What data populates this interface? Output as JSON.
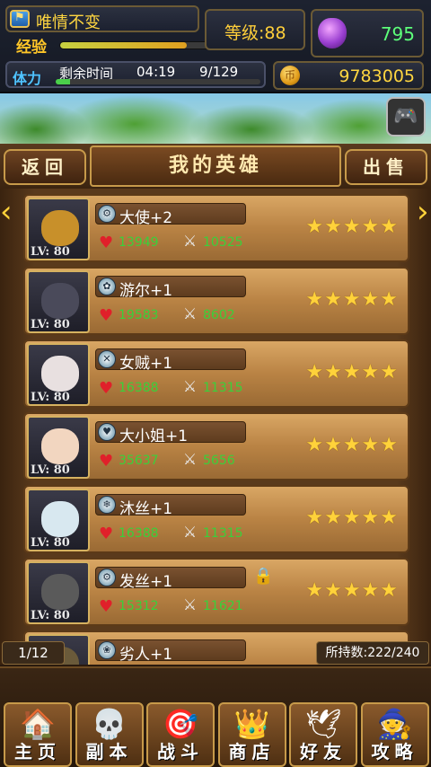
{
  "status": {
    "player_name": "唯情不变",
    "exp_label": "经验",
    "exp_progress": 0.62,
    "level_text": "等级:88",
    "gems": "795",
    "stamina_label": "体力",
    "remaining_time_label": "剩余时间",
    "remaining_time": "04:19",
    "stamina": "9/129",
    "stamina_progress": 0.07,
    "gold": "9783005"
  },
  "header": {
    "back_label": "返回",
    "title": "我的英雄",
    "sell_label": "出售"
  },
  "heroes": [
    {
      "name": "大使+2",
      "lv": "LV: 80",
      "hp": "13949",
      "atk": "10525",
      "stars": "★★★★★",
      "locked": false,
      "face_color": "#c8902a"
    },
    {
      "name": "游尔+1",
      "lv": "LV: 80",
      "hp": "19583",
      "atk": "8602",
      "stars": "★★★★★",
      "locked": false,
      "face_color": "#4a4a5a"
    },
    {
      "name": "女贼+1",
      "lv": "LV: 80",
      "hp": "16388",
      "atk": "11315",
      "stars": "★★★★★",
      "locked": false,
      "face_color": "#e8e0e0"
    },
    {
      "name": "大小姐+1",
      "lv": "LV: 80",
      "hp": "35637",
      "atk": "5656",
      "stars": "★★★★★",
      "locked": false,
      "face_color": "#f2d6c0"
    },
    {
      "name": "沐丝+1",
      "lv": "LV: 80",
      "hp": "16388",
      "atk": "11315",
      "stars": "★★★★★",
      "locked": false,
      "face_color": "#d8e8f0"
    },
    {
      "name": "发丝+1",
      "lv": "LV: 80",
      "hp": "15312",
      "atk": "11621",
      "stars": "★★★★★",
      "locked": true,
      "face_color": "#5a5a5a"
    },
    {
      "name": "劣人+1",
      "lv": "",
      "hp": "",
      "atk": "",
      "stars": "",
      "locked": false,
      "face_color": "#6a5a3a"
    }
  ],
  "footer": {
    "page": "1/12",
    "count": "所持数:222/240"
  },
  "nav": [
    {
      "label": "主页",
      "icon": "house-icon"
    },
    {
      "label": "副本",
      "icon": "skull-icon"
    },
    {
      "label": "战斗",
      "icon": "target-icon"
    },
    {
      "label": "商店",
      "icon": "shop-icon"
    },
    {
      "label": "好友",
      "icon": "wings-icon"
    },
    {
      "label": "攻略",
      "icon": "wizard-icon"
    }
  ],
  "colors": {
    "gold_text": "#ffd640",
    "green_value": "#3ad03a",
    "star": "#ffd23a"
  }
}
